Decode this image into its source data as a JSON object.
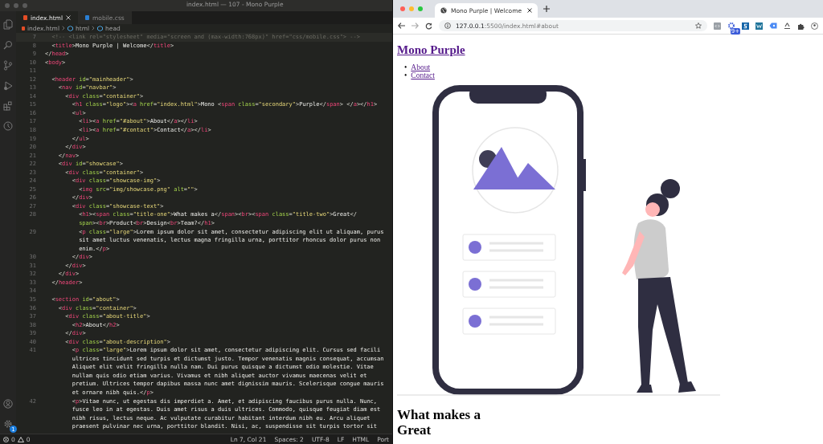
{
  "editor": {
    "window_title": "index.html — 107 - Mono Purple",
    "tabs": [
      {
        "label": "index.html",
        "kind": "html",
        "selected": true
      },
      {
        "label": "mobile.css",
        "kind": "css",
        "selected": false
      }
    ],
    "breadcrumbs": [
      "index.html",
      "html",
      "head"
    ],
    "settings_badge": "1",
    "code_lines": [
      {
        "number": "7",
        "text": "  <!-- <link rel=\"stylesheet\" media=\"screen and (max-width:768px)\" href=\"css/mobile.css\"> -->"
      },
      {
        "number": "8",
        "text": "  <title>Mono Purple | Welcome</title>"
      },
      {
        "number": "9",
        "text": "</head>"
      },
      {
        "number": "10",
        "text": "<body>"
      },
      {
        "number": "11"
      },
      {
        "number": "12",
        "text": "  <header id=\"mainheader\">"
      },
      {
        "number": "13",
        "text": "    <nav id=\"navbar\">"
      },
      {
        "number": "14",
        "text": "      <div class=\"container\">"
      },
      {
        "number": "15",
        "text": "        <h1 class=\"logo\"><a href=\"index.html\">Mono <span class=\"secondary\">Purple</span> </a></h1>"
      },
      {
        "number": "16",
        "text": "        <ul>"
      },
      {
        "number": "17",
        "text": "          <li><a href=\"#about\">About</a></li>"
      },
      {
        "number": "18",
        "text": "          <li><a href=\"#contact\">Contact</a></li>"
      },
      {
        "number": "19",
        "text": "        </ul>"
      },
      {
        "number": "20",
        "text": "      </div>"
      },
      {
        "number": "21",
        "text": "    </nav>"
      },
      {
        "number": "22",
        "text": "    <div id=\"showcase\">"
      },
      {
        "number": "23",
        "text": "      <div class=\"container\">"
      },
      {
        "number": "24",
        "text": "        <div class=\"showcase-img\">"
      },
      {
        "number": "25",
        "text": "          <img src=\"img/showcase.png\" alt=\"\">"
      },
      {
        "number": "26",
        "text": "        </div>"
      },
      {
        "number": "27",
        "text": "        <div class=\"showcase-text\">"
      },
      {
        "number": "28",
        "text": "          <h1><span class=\"title-one\">What makes a</span><br><span class=\"title-two\">Great</"
      },
      {
        "text": "          span><br>Product<br>Design<br>Team?</h1>"
      },
      {
        "number": "29",
        "text": "          <p class=\"large\">Lorem ipsum dolor sit amet, consectetur adipiscing elit ut aliquam, purus"
      },
      {
        "text": "          sit amet luctus venenatis, lectus magna fringilla urna, porttitor rhoncus dolor purus non"
      },
      {
        "text": "          enim.</p>"
      },
      {
        "number": "30",
        "text": "        </div>"
      },
      {
        "number": "31",
        "text": "      </div>"
      },
      {
        "number": "32",
        "text": "    </div>"
      },
      {
        "number": "33",
        "text": "  </header>"
      },
      {
        "number": "34"
      },
      {
        "number": "35",
        "text": "  <section id=\"about\">"
      },
      {
        "number": "36",
        "text": "    <div class=\"container\">"
      },
      {
        "number": "37",
        "text": "      <div class=\"about-title\">"
      },
      {
        "number": "38",
        "text": "        <h2>About</h2>"
      },
      {
        "number": "39",
        "text": "      </div>"
      },
      {
        "number": "40",
        "text": "      <div class=\"about-description\">"
      },
      {
        "number": "41",
        "text": "        <p class=\"large\">Lorem ipsum dolor sit amet, consectetur adipiscing elit. Cursus sed facili"
      },
      {
        "text": "        ultrices tincidunt sed turpis et dictumst justo. Tempor venenatis magnis consequat, accumsan"
      },
      {
        "text": "        Aliquet elit velit fringilla nulla nam. Dui purus quisque a dictumst odio molestie. Vitae"
      },
      {
        "text": "        nullam quis odio etiam varius. Vivamus et nibh aliquet auctor vivamus maecenas velit et"
      },
      {
        "text": "        pretium. Ultrices tempor dapibus massa nunc amet dignissim mauris. Scelerisque congue mauris"
      },
      {
        "text": "        et ornare nibh quis.</p>"
      },
      {
        "number": "42",
        "text": "        <p>Vitae nunc, ut egestas dis imperdiet a. Amet, et adipiscing faucibus purus nulla. Nunc,"
      },
      {
        "text": "        fusce leo in at egestas. Duis amet risus a duis ultrices. Commodo, quisque feugiat diam est"
      },
      {
        "text": "        nibh risus, lectus neque. Ac vulputate curabitur habitant interdum nibh eu. Arcu aliquet"
      },
      {
        "text": "        praesent pulvinar nec urna, porttitor blandit. Nisi, ac, suspendisse sit turpis tortor sit"
      }
    ],
    "status_bar": {
      "errors": "0",
      "warnings": "0",
      "items": [
        "Ln 7, Col 21",
        "Spaces: 2",
        "UTF-8",
        "LF",
        "HTML",
        "Port"
      ]
    }
  },
  "browser": {
    "tabs": [
      {
        "title": "Mono Purple | Welcome",
        "selected": true
      }
    ],
    "url": {
      "host": "127.0.0.1",
      "path": ":5500/index.html#about"
    },
    "extension_badge": "9+",
    "page": {
      "logo": "Mono Purple",
      "nav_links": [
        {
          "bullet": "•",
          "label": "About"
        },
        {
          "bullet": "•",
          "label": "Contact"
        }
      ],
      "headline": [
        "What makes a",
        "Great"
      ]
    }
  }
}
